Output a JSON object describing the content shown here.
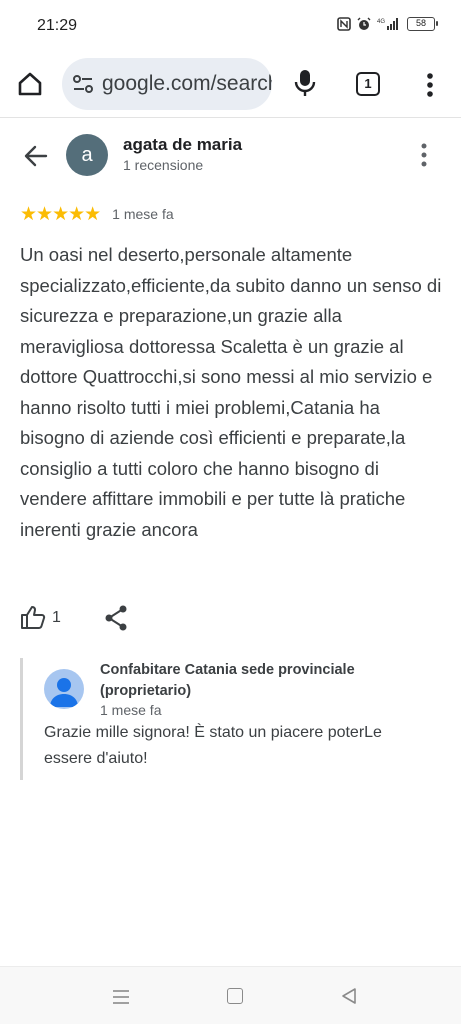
{
  "status_bar": {
    "time": "21:29",
    "battery": "58"
  },
  "browser": {
    "url": "google.com/search",
    "tab_count": "1"
  },
  "review": {
    "avatar_letter": "a",
    "author": "agata de maria",
    "author_reviews": "1 recensione",
    "rating": 5,
    "stars": "★★★★★",
    "date": "1 mese fa",
    "text": "Un oasi nel deserto,personale altamente specializzato,efficiente,da subito danno un senso di sicurezza e preparazione,un grazie alla meravigliosa dottoressa Scaletta è un grazie al dottore Quattrocchi,si sono messi al mio servizio e hanno risolto tutti i miei problemi,Catania ha bisogno di aziende così efficienti e preparate,la consiglio a tutti coloro che hanno bisogno di vendere affittare immobili e per tutte là pratiche inerenti grazie ancora",
    "like_count": "1"
  },
  "owner_reply": {
    "name": "Confabitare Catania sede provinciale (proprietario)",
    "date": "1 mese fa",
    "text": "Grazie mille signora! È stato un piacere poterLe essere d'aiuto!"
  },
  "colors": {
    "star": "#fbbc04",
    "avatar_bg": "#546e7a",
    "url_bar_bg": "#e9edf3"
  },
  "icons": {
    "home": "home-icon",
    "site_settings": "tune-icon",
    "mic": "mic-icon",
    "menu": "more-vert-icon",
    "back": "arrow-back-icon",
    "like": "thumb-up-icon",
    "share": "share-icon"
  }
}
